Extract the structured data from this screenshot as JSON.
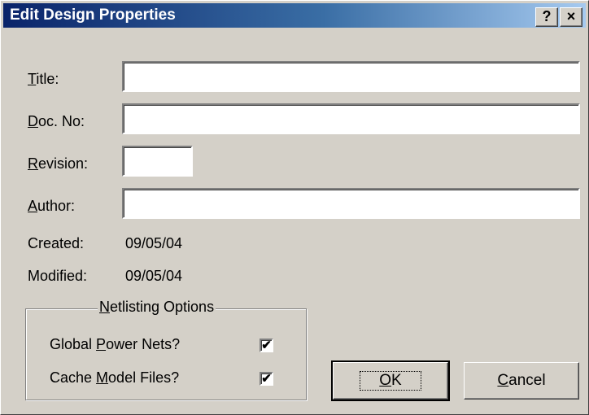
{
  "window": {
    "title": "Edit Design Properties",
    "help_button": "?",
    "close_button": "×"
  },
  "fields": {
    "title": {
      "label_mnemonic": "T",
      "label_rest": "itle:",
      "value": ""
    },
    "doc_no": {
      "label_mnemonic": "D",
      "label_rest": "oc. No:",
      "value": ""
    },
    "revision": {
      "label_mnemonic": "R",
      "label_rest": "evision:",
      "value": ""
    },
    "author": {
      "label_mnemonic": "A",
      "label_rest": "uthor:",
      "value": ""
    }
  },
  "info": {
    "created_label": "Created:",
    "created_value": "09/05/04",
    "modified_label": "Modified:",
    "modified_value": "09/05/04"
  },
  "netlisting": {
    "group_mnemonic": "N",
    "group_rest": "etlisting Options",
    "global_power": {
      "pre": "Global ",
      "mnemonic": "P",
      "post": "ower Nets?",
      "checked": true,
      "mark": "✔"
    },
    "cache_model": {
      "pre": "Cache ",
      "mnemonic": "M",
      "post": "odel Files?",
      "checked": true,
      "mark": "✔"
    }
  },
  "buttons": {
    "ok": {
      "mnemonic": "O",
      "rest": "K"
    },
    "cancel": {
      "mnemonic": "C",
      "rest": "ancel"
    }
  }
}
